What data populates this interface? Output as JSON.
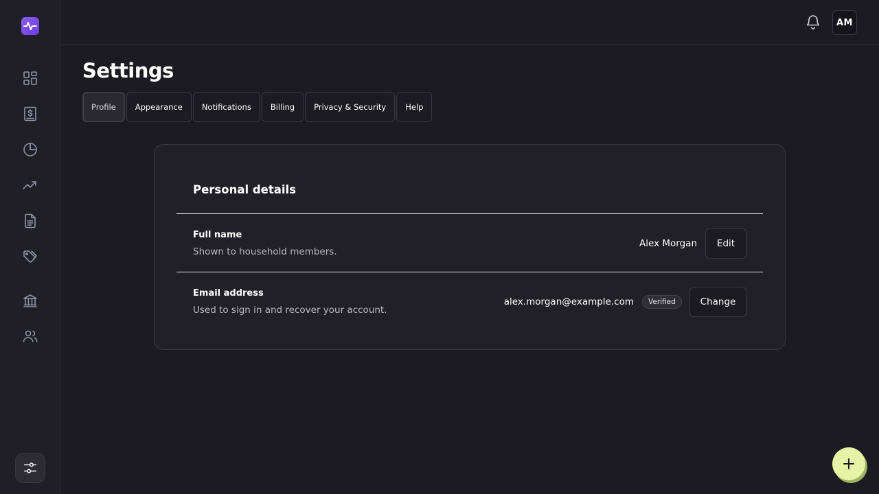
{
  "header": {
    "page_title": "Settings",
    "avatar_initials": "AM"
  },
  "sidebar": {
    "items": [
      {
        "icon": "dashboard-icon"
      },
      {
        "icon": "receipt-icon"
      },
      {
        "icon": "pie-chart-icon"
      },
      {
        "icon": "trending-up-icon"
      },
      {
        "icon": "document-icon"
      },
      {
        "icon": "tags-icon"
      },
      {
        "icon": "bank-icon"
      },
      {
        "icon": "users-icon"
      }
    ],
    "bottom_icon": "sliders-icon"
  },
  "tabs": [
    {
      "label": "Profile",
      "active": true
    },
    {
      "label": "Appearance"
    },
    {
      "label": "Notifications"
    },
    {
      "label": "Billing"
    },
    {
      "label": "Privacy & Security"
    },
    {
      "label": "Help"
    }
  ],
  "card": {
    "title": "Personal details",
    "rows": [
      {
        "label": "Full name",
        "description": "Shown to household members.",
        "value": "Alex Morgan",
        "action": "Edit"
      },
      {
        "label": "Email address",
        "description": "Used to sign in and recover your account.",
        "value": "alex.morgan@example.com",
        "badge": "Verified",
        "action": "Change"
      }
    ]
  },
  "colors": {
    "background": "#1c1b21",
    "sidebar": "#201f26",
    "logo": "#7c4dea",
    "fab": "#e6f2a6"
  }
}
